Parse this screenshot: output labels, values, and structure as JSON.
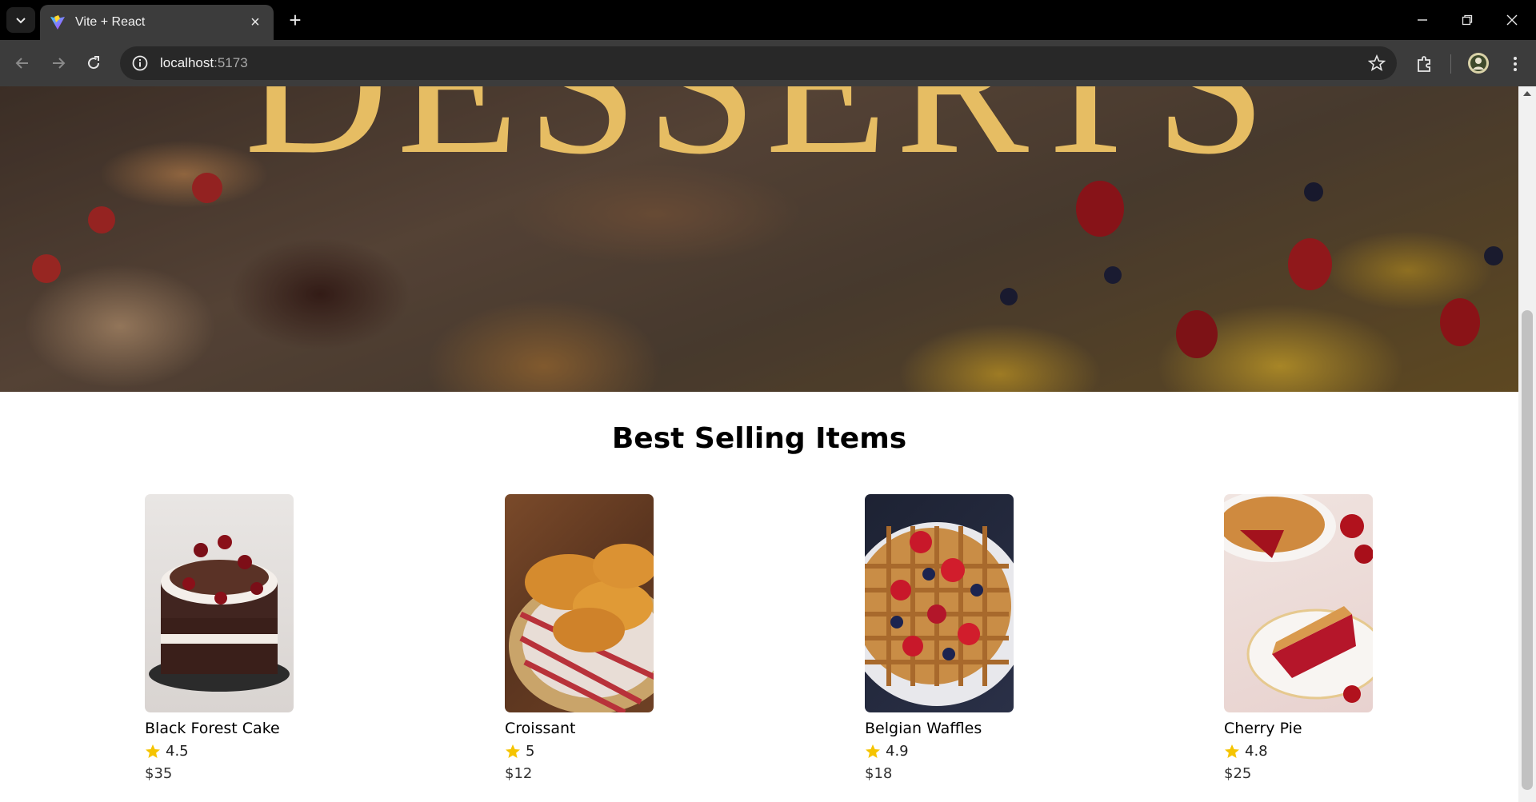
{
  "browser": {
    "tab_title": "Vite + React",
    "url_host": "localhost",
    "url_port": ":5173"
  },
  "hero": {
    "title": "DESSERTS"
  },
  "best_selling": {
    "heading": "Best Selling Items",
    "items": [
      {
        "name": "Black Forest Cake",
        "rating": "4.5",
        "price": "$35"
      },
      {
        "name": "Croissant",
        "rating": "5",
        "price": "$12"
      },
      {
        "name": "Belgian Waffles",
        "rating": "4.9",
        "price": "$18"
      },
      {
        "name": "Cherry Pie",
        "rating": "4.8",
        "price": "$25"
      }
    ]
  },
  "colors": {
    "hero_title": "#e6bd63",
    "star": "#f5c400",
    "tab_active": "#3c3c3c",
    "chrome_bg": "#000000"
  }
}
